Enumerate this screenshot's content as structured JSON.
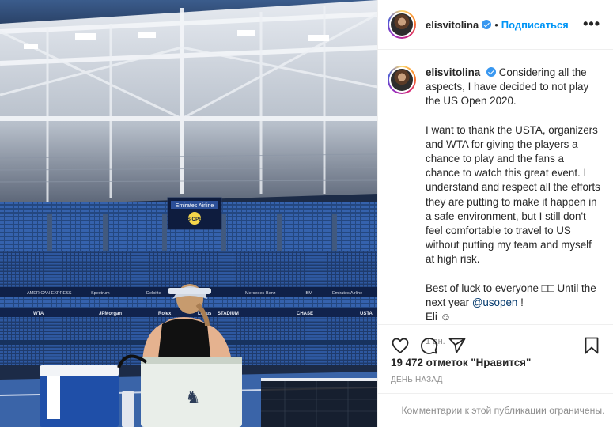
{
  "post": {
    "username": "elisvitolina",
    "follow_label": "Подписаться",
    "more_label": "•••",
    "caption": {
      "username": "elisvitolina",
      "p1": "Considering all the aspects, I have decided to not play the US Open 2020.",
      "p2": "I want to thank the USTA, organizers and WTA for giving the players a chance to play and the fans a chance to watch this great event. I understand and respect all the efforts they are putting to make it happen in a safe environment, but I still don't feel comfortable to travel to US without putting my team and myself at high risk.",
      "p3_start": "Best of luck to everyone □□ Until the next year ",
      "mention": "@usopen",
      "p3_end": " !",
      "signoff": "Eli ☺"
    },
    "time_ago": "1 дн.",
    "likes": "19 472 отметок \"Нравится\"",
    "date_label": "ДЕНЬ НАЗАД",
    "comments_disabled": "Комментарии к этой публикации ограничены."
  },
  "photo": {
    "scoreboard_top": "Emirates Airline",
    "scoreboard_logo": "US OPEN",
    "banners": [
      "AMERICAN EXPRESS",
      "Spectrum",
      "Deloitte",
      "Mercedes-Benz",
      "IBM",
      "Emirates Airline"
    ],
    "banners_lower": [
      "WTA",
      "JPMorgan",
      "Rolex",
      "Lexus",
      "STADIUM",
      "CHASE",
      "USTA"
    ],
    "colors": {
      "sky": "#1c2b47",
      "roof": "#cfd5dd",
      "seats": "#2f5aa8",
      "court": "#3a64a8"
    }
  },
  "icons": [
    "heart-icon",
    "comment-icon",
    "share-icon",
    "bookmark-icon",
    "verified-icon"
  ]
}
